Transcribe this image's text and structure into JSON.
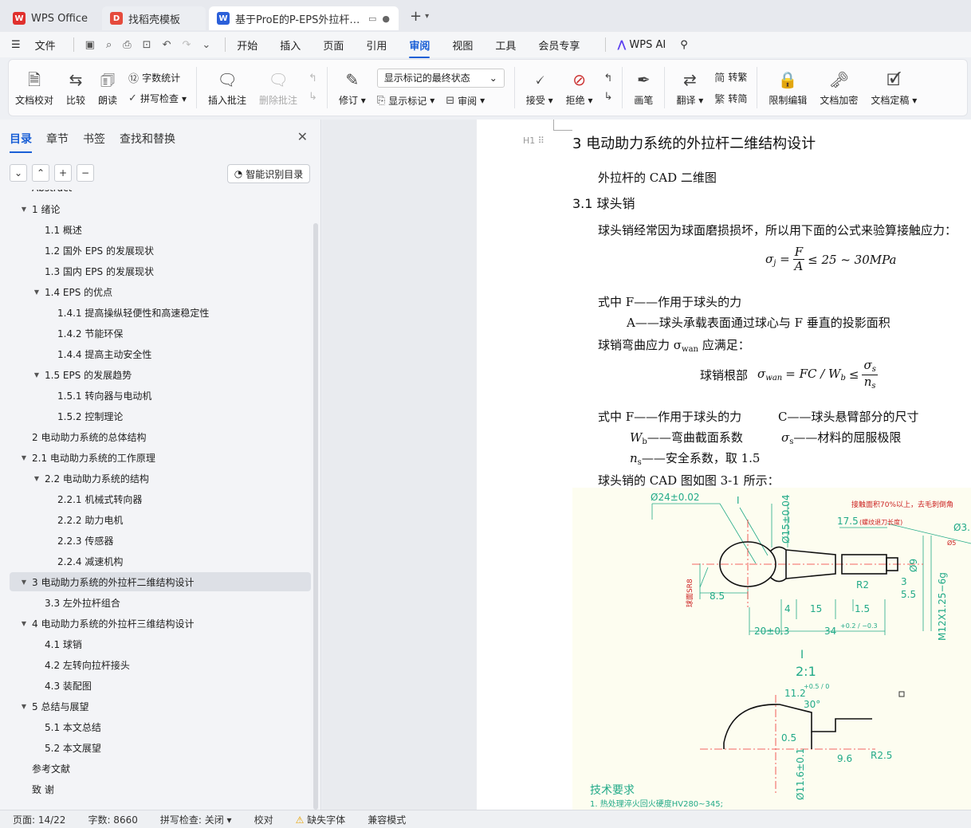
{
  "tabs": [
    {
      "label": "WPS Office",
      "icon": "wps-logo-icon",
      "color": "#e0302d"
    },
    {
      "label": "找稻壳模板",
      "icon": "docer-icon",
      "color": "#e54b3c"
    },
    {
      "label": "基于ProE的P-EPS外拉杆结构设计",
      "icon": "word-doc-icon",
      "color": "#2b5fd9"
    }
  ],
  "menu": {
    "file": "文件",
    "items": [
      "开始",
      "插入",
      "页面",
      "引用",
      "审阅",
      "视图",
      "工具",
      "会员专享"
    ],
    "active": "审阅",
    "ai": "WPS AI"
  },
  "ribbon": {
    "doc_check": "文档校对",
    "compare": "比较",
    "read_aloud": "朗读",
    "word_count": "字数统计",
    "spell_check": "拼写检查",
    "insert_comment": "插入批注",
    "delete_comment": "删除批注",
    "revise": "修订",
    "markup_state": "显示标记的最终状态",
    "show_markup": "显示标记",
    "review": "审阅",
    "accept": "接受",
    "reject": "拒绝",
    "pen": "画笔",
    "translate": "翻译",
    "to_traditional": "转繁",
    "to_simplified": "转简",
    "restrict_edit": "限制编辑",
    "encrypt": "文档加密",
    "finalize": "文档定稿"
  },
  "nav": {
    "tabs": [
      "目录",
      "章节",
      "书签",
      "查找和替换"
    ],
    "active_tab": "目录",
    "smart_toc": "智能识别目录",
    "toc": [
      {
        "label": "Abstract",
        "level": 1,
        "caret": ""
      },
      {
        "label": "1  绪论",
        "level": 1,
        "caret": "▼"
      },
      {
        "label": "1.1  概述",
        "level": 2,
        "caret": ""
      },
      {
        "label": "1.2  国外 EPS 的发展现状",
        "level": 2,
        "caret": ""
      },
      {
        "label": "1.3  国内 EPS 的发展现状",
        "level": 2,
        "caret": ""
      },
      {
        "label": "1.4    EPS 的优点",
        "level": 2,
        "caret": "▼"
      },
      {
        "label": "1.4.1  提高操纵轻便性和高速稳定性",
        "level": 3,
        "caret": ""
      },
      {
        "label": "1.4.2  节能环保",
        "level": 3,
        "caret": ""
      },
      {
        "label": "1.4.4  提高主动安全性",
        "level": 3,
        "caret": ""
      },
      {
        "label": "1.5    EPS 的发展趋势",
        "level": 2,
        "caret": "▼"
      },
      {
        "label": "1.5.1  转向器与电动机",
        "level": 3,
        "caret": ""
      },
      {
        "label": "1.5.2  控制理论",
        "level": 3,
        "caret": ""
      },
      {
        "label": "2  电动助力系统的总体结构",
        "level": 1,
        "caret": ""
      },
      {
        "label": "2.1  电动助力系统的工作原理",
        "level": 1,
        "caret": "▼"
      },
      {
        "label": "2.2  电动助力系统的结构",
        "level": 2,
        "caret": "▼"
      },
      {
        "label": "2.2.1  机械式转向器",
        "level": 3,
        "caret": ""
      },
      {
        "label": "2.2.2  助力电机",
        "level": 3,
        "caret": ""
      },
      {
        "label": "2.2.3  传感器",
        "level": 3,
        "caret": ""
      },
      {
        "label": "2.2.4  减速机构",
        "level": 3,
        "caret": ""
      },
      {
        "label": "3  电动助力系统的外拉杆二维结构设计",
        "level": 1,
        "caret": "▼",
        "selected": true
      },
      {
        "label": "3.3  左外拉杆组合",
        "level": 2,
        "caret": ""
      },
      {
        "label": "4  电动助力系统的外拉杆三维结构设计",
        "level": 1,
        "caret": "▼"
      },
      {
        "label": "4.1  球销",
        "level": 2,
        "caret": ""
      },
      {
        "label": "4.2  左转向拉杆接头",
        "level": 2,
        "caret": ""
      },
      {
        "label": "4.3  装配图",
        "level": 2,
        "caret": ""
      },
      {
        "label": "5  总结与展望",
        "level": 1,
        "caret": "▼"
      },
      {
        "label": "5.1  本文总结",
        "level": 2,
        "caret": ""
      },
      {
        "label": "5.2  本文展望",
        "level": 2,
        "caret": ""
      },
      {
        "label": "参考文献",
        "level": 1,
        "caret": ""
      },
      {
        "label": "致      谢",
        "level": 1,
        "caret": ""
      }
    ]
  },
  "document": {
    "heading_mark": "H1",
    "h1": "3  电动助力系统的外拉杆二维结构设计",
    "p_cad": "外拉杆的 CAD 二维图",
    "h2": "3.1  球头销",
    "p1": "球头销经常因为球面磨损损坏，所以用下面的公式来验算接触应力：",
    "f1_lhs": "σ",
    "f1_lhs_sub": "j",
    "f1_num": "F",
    "f1_den": "A",
    "f1_rhs": "≤ 25 ~ 30MPa",
    "def1": "式中 F——作用于球头的力",
    "def2": "A——球头承载表面通过球心与 F 垂直的投影面积",
    "p2_a": "球销弯曲应力 σ",
    "p2_sub": "wan",
    "p2_b": " 应满足：",
    "f2_label": "球销根部",
    "f2_lhs": "σ",
    "f2_lhs_sub": "wan",
    "f2_mid": "= FC / W",
    "f2_mid_sub": "b",
    "f2_le": "≤",
    "f2_num": "σ",
    "f2_num_sub": "s",
    "f2_den": "n",
    "f2_den_sub": "s",
    "def3_a": "式中  F——作用于球头的力",
    "def3_b": "C——球头悬臂部分的尺寸",
    "def4_a": "W",
    "def4_a_sub": "b",
    "def4_a_rest": "——弯曲截面系数",
    "def4_b": "σ",
    "def4_b_sub": "s",
    "def4_b_rest": "——材料的屈服极限",
    "def5": "n",
    "def5_sub": "s",
    "def5_rest": "——安全系数，取 1.5",
    "p3": "球头销的 CAD 图如图 3-1 所示：",
    "cad": {
      "dim_sphere": "Ø24±0.02",
      "detail_mark": "I",
      "dim_neck": "Ø15±0.04",
      "note_top": "接触面积70%以上，去毛刺倒角",
      "dim_len": "17.5",
      "dim_len_note": "(螺纹退刀长度)",
      "dim_right": "Ø3.",
      "dim_right2": "Ø5",
      "dim_8_5": "8.5",
      "dim_r2": "R2",
      "dim_3": "3",
      "dim_5_5": "5.5",
      "dim_phi9": "Ø9",
      "dim_4": "4",
      "dim_15": "15",
      "dim_1_5": "1.5",
      "dim_20": "20±0.3",
      "dim_34": "34",
      "dim_34_tol": "+0.2 / −0.3",
      "thread": "M12X1.25−6g",
      "left_note": "球面SR8",
      "scale_mark": "I",
      "scale": "2:1",
      "dim_11_2": "11.2",
      "dim_11_2_tol": "+0.5 / 0",
      "dim_30": "30°",
      "dim_0_5": "0.5",
      "dim_9_6": "9.6",
      "dim_r2_5": "R2.5",
      "dim_phi11": "Ø11.6±0.1",
      "tech_title": "技术要求",
      "tech_1": "1. 热处理淬火回火硬度HV280~345;"
    }
  },
  "status": {
    "page": "页面: 14/22",
    "words": "字数: 8660",
    "spell": "拼写检查: 关闭",
    "proof": "校对",
    "missing_font": "缺失字体",
    "compat": "兼容模式"
  }
}
